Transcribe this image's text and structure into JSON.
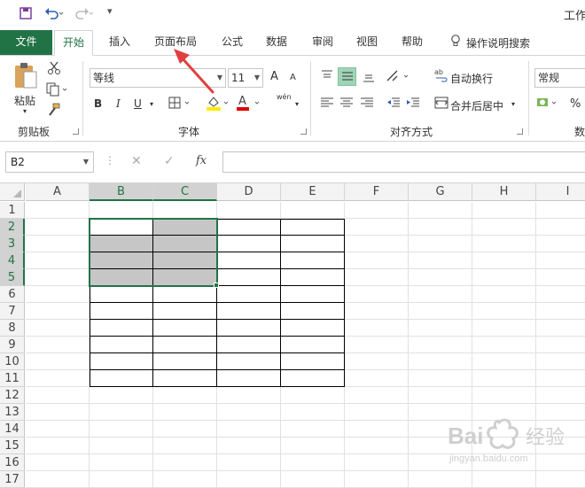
{
  "window": {
    "title": "工作"
  },
  "tabs": [
    {
      "label": "文件"
    },
    {
      "label": "开始"
    },
    {
      "label": "插入"
    },
    {
      "label": "页面布局"
    },
    {
      "label": "公式"
    },
    {
      "label": "数据"
    },
    {
      "label": "审阅"
    },
    {
      "label": "视图"
    },
    {
      "label": "帮助"
    }
  ],
  "tell_me": "操作说明搜索",
  "ribbon": {
    "clipboard": {
      "paste": "粘贴",
      "label": "剪贴板"
    },
    "font": {
      "name": "等线",
      "size": "11",
      "label": "字体",
      "bold": "B",
      "italic": "I",
      "underline": "U",
      "grow": "A",
      "shrink": "A",
      "font_color_glyph": "A",
      "phonetic": "wén"
    },
    "alignment": {
      "wrap": "自动换行",
      "merge": "合并后居中",
      "label": "对齐方式"
    },
    "number": {
      "format": "常规",
      "percent": "%",
      "label": "数"
    }
  },
  "formula_bar": {
    "name_box": "B2",
    "fx": "fx",
    "value": ""
  },
  "columns": [
    "A",
    "B",
    "C",
    "D",
    "E",
    "F",
    "G",
    "H",
    "I"
  ],
  "rows": [
    "1",
    "2",
    "3",
    "4",
    "5",
    "6",
    "7",
    "8",
    "9",
    "10",
    "11",
    "12",
    "13",
    "14",
    "15",
    "16",
    "17"
  ],
  "selection": {
    "range": "B2:C5",
    "active_cell": "B2"
  },
  "colors": {
    "accent": "#217346",
    "annotation": "#e04040",
    "fill": "#c6c6c6"
  },
  "watermark": {
    "brand": "Bai",
    "sub": "jingyan.baidu.com",
    "suffix": "经验"
  }
}
